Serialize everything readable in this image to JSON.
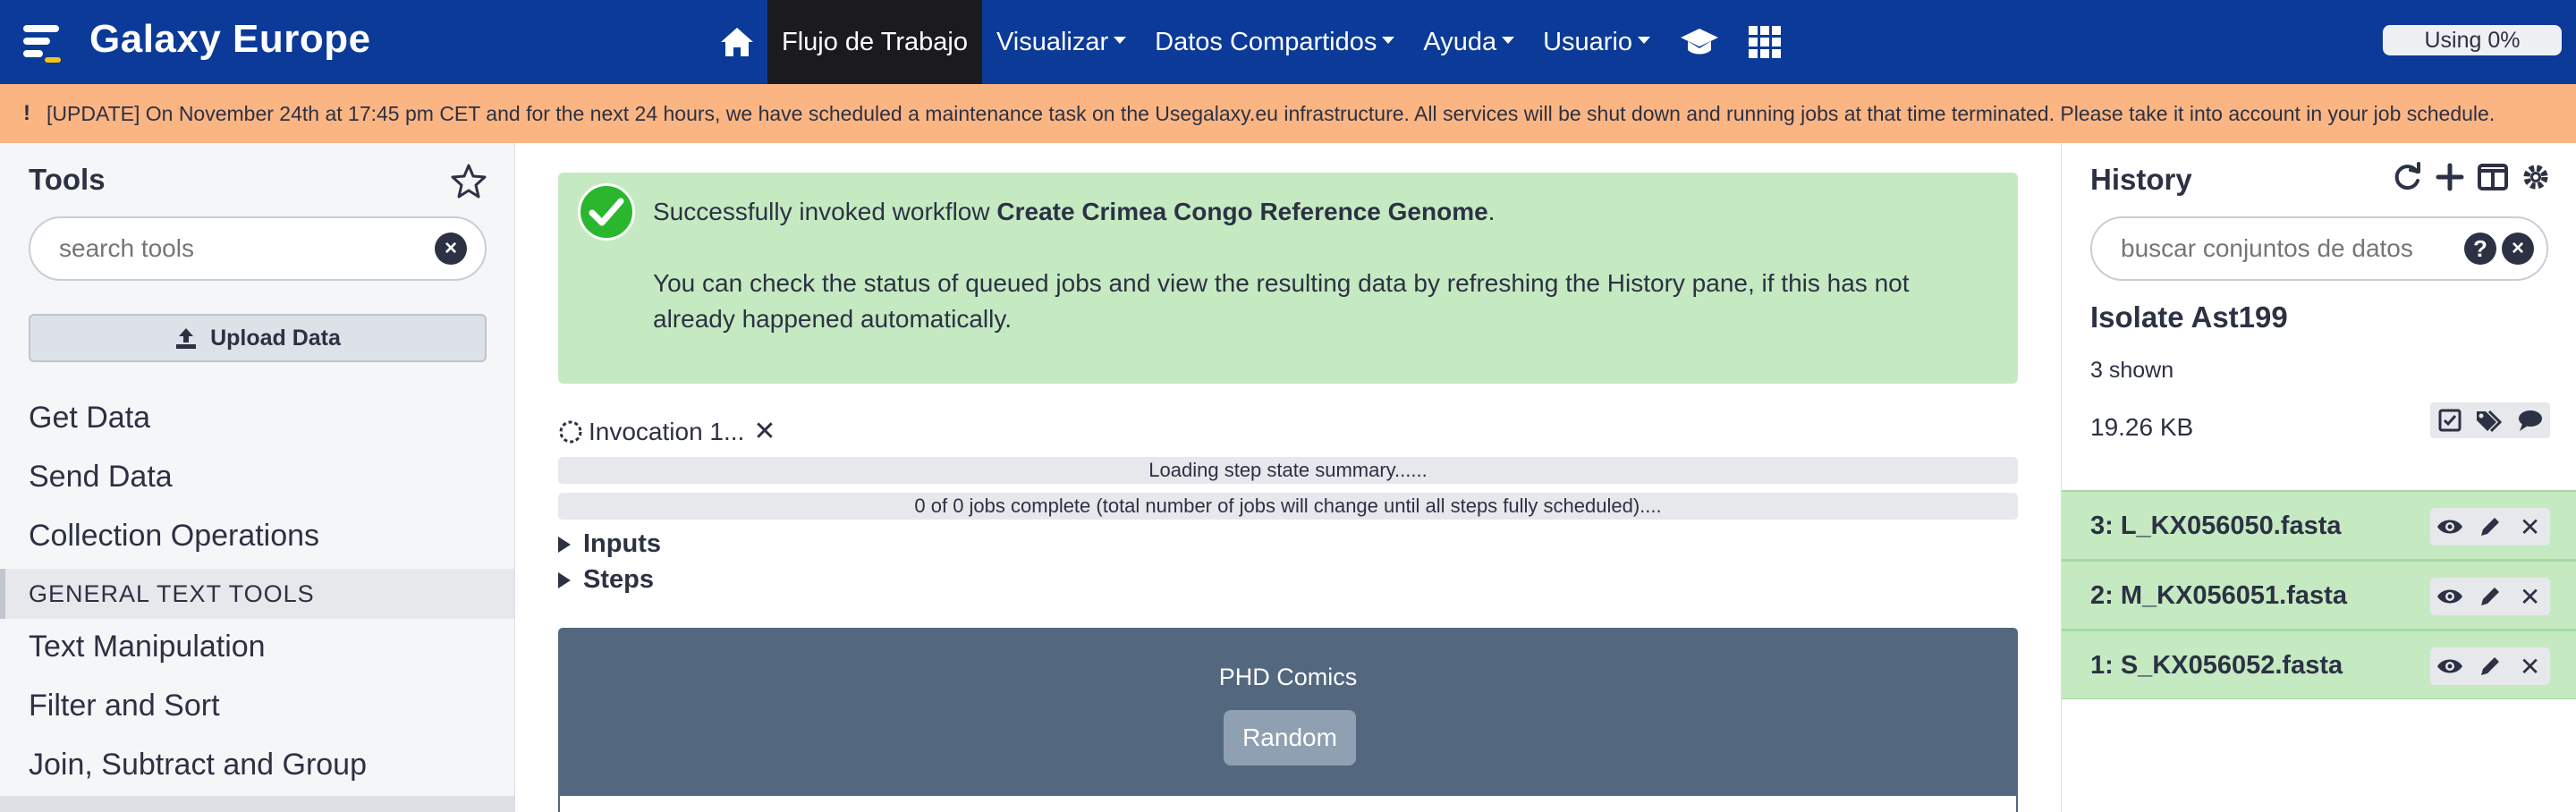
{
  "masthead": {
    "brand": "Galaxy Europe",
    "nav": [
      {
        "label": "Flujo de Trabajo",
        "active": true,
        "dropdown": false
      },
      {
        "label": "Visualizar",
        "active": false,
        "dropdown": true
      },
      {
        "label": "Datos Compartidos",
        "active": false,
        "dropdown": true
      },
      {
        "label": "Ayuda",
        "active": false,
        "dropdown": true
      },
      {
        "label": "Usuario",
        "active": false,
        "dropdown": true
      }
    ],
    "icons": [
      "home-icon",
      "graduation-cap-icon",
      "grid-icon"
    ],
    "usage": "Using 0%"
  },
  "banner": {
    "icon": "!",
    "text": "[UPDATE] On November 24th at 17:45 pm CET and for the next 24 hours, we have scheduled a maintenance task on the Usegalaxy.eu infrastructure. All services will be shut down and running jobs at that time terminated. Please take it into account in your job schedule."
  },
  "tools": {
    "title": "Tools",
    "search_placeholder": "search tools",
    "upload_label": "Upload Data",
    "sections": [
      "Get Data",
      "Send Data",
      "Collection Operations"
    ],
    "label": "GENERAL TEXT TOOLS",
    "sections2": [
      "Text Manipulation",
      "Filter and Sort",
      "Join, Subtract and Group"
    ]
  },
  "center": {
    "success_prefix": "Successfully invoked workflow ",
    "workflow_name": "Create Crimea Congo Reference Genome",
    "success_suffix": ".",
    "success_detail": "You can check the status of queued jobs and view the resulting data by refreshing the History pane, if this has not already happened automatically.",
    "invocation_label": "Invocation 1...",
    "loading_text": "Loading step state summary......",
    "jobs_text": "0 of 0 jobs complete (total number of jobs will change until all steps fully scheduled)....",
    "inputs_label": "Inputs",
    "steps_label": "Steps",
    "comics_title": "PHD Comics",
    "random_label": "Random"
  },
  "history": {
    "title": "History",
    "search_placeholder": "buscar conjuntos de datos",
    "name": "Isolate Ast199",
    "shown": "3 shown",
    "size": "19.26 KB",
    "datasets": [
      {
        "name": "3: L_KX056050.fasta",
        "state": "ok"
      },
      {
        "name": "2: M_KX056051.fasta",
        "state": "ok"
      },
      {
        "name": "1: S_KX056052.fasta",
        "state": "ok"
      }
    ],
    "colors": {
      "ok": "#c5eac2",
      "masthead": "#0b3a98",
      "banner": "#fbb583"
    }
  }
}
